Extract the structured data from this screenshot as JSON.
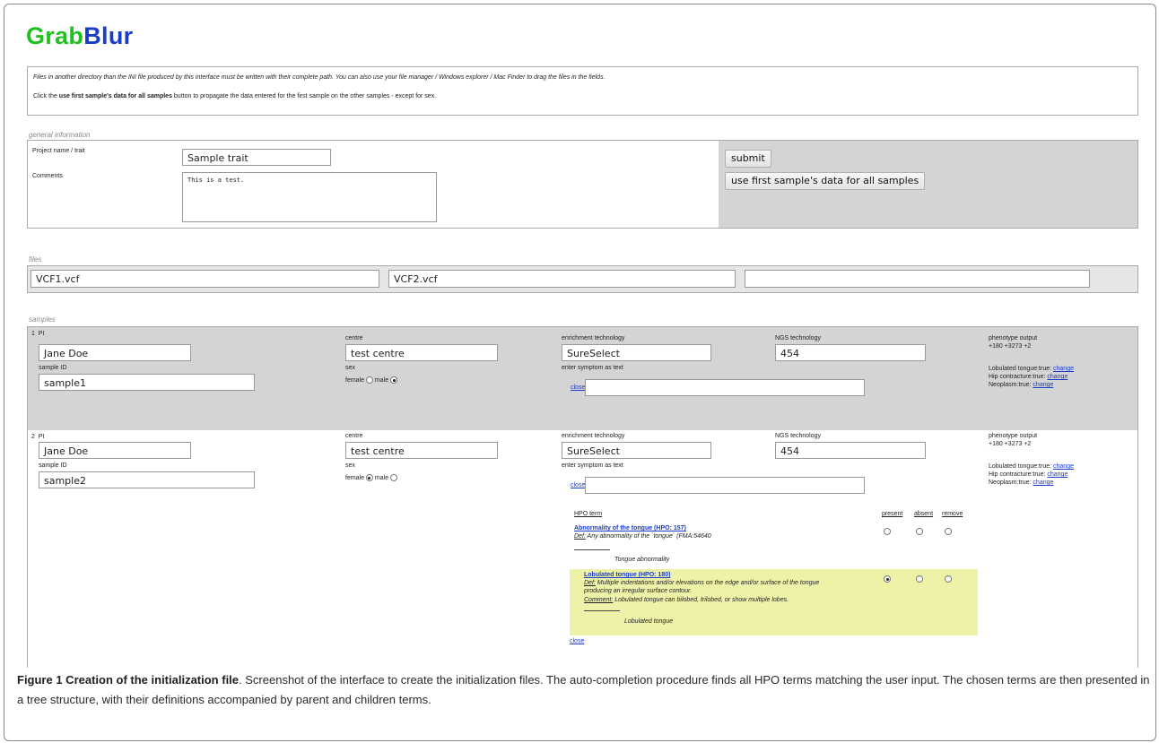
{
  "app": {
    "logo_part1": "Grab",
    "logo_part2": "Blur"
  },
  "info": {
    "line1": "Files in another directory than the INI file produced by this interface must be written with their complete path. You can also use your file manager / Windows explorer / Mac Finder to drag the files in the fields.",
    "line2_pre": "Click the ",
    "line2_bold": "use first sample's data for all samples",
    "line2_post": " button to propagate the data entered for the first sample on the other samples - except for sex."
  },
  "general": {
    "heading": "general information",
    "project_label": "Project name / trait",
    "project_value": "Sample trait",
    "comments_label": "Comments",
    "comments_value": "This is a test.",
    "submit_label": "submit",
    "use_first_label": "use first sample's data for all samples"
  },
  "files": {
    "heading": "files",
    "values": [
      "VCF1.vcf",
      "VCF2.vcf",
      ""
    ]
  },
  "samples": {
    "heading": "samples",
    "labels": {
      "pi": "PI",
      "sample_id": "sample ID",
      "centre": "centre",
      "sex": "sex",
      "female": "female",
      "male": "male",
      "enrichment": "enrichment technology",
      "ngs": "NGS technology",
      "symptom": "enter symptom as text",
      "close": "close",
      "phenotype_output": "phenotype output",
      "change": "change"
    },
    "items": [
      {
        "number": "1",
        "pi": "Jane Doe",
        "sample_id": "sample1",
        "centre": "test centre",
        "sex": "male",
        "enrichment": "SureSelect",
        "ngs": "454",
        "symptom": "",
        "phenotype_codes": "+180 +3273 +2",
        "phenotypes": [
          "Lobulated tongue:true:",
          "Hip contracture:true:",
          "Neoplasm:true:"
        ]
      },
      {
        "number": "2",
        "pi": "Jane Doe",
        "sample_id": "sample2",
        "centre": "test centre",
        "sex": "female",
        "enrichment": "SureSelect",
        "ngs": "454",
        "symptom": "",
        "phenotype_codes": "+180 +3273 +2",
        "phenotypes": [
          "Lobulated tongue:true:",
          "Hip contracture:true:",
          "Neoplasm:true:"
        ]
      }
    ]
  },
  "hpo": {
    "col_term": "HPO term",
    "col_present": "present",
    "col_absent": "absent",
    "col_remove": "remove",
    "terms": [
      {
        "title": "Abnormality of the tongue (HPO: 157)",
        "def_label": "Def:",
        "def": " Any abnormality of the `tongue` (FMA:54640",
        "child": "Tongue abnormality",
        "state": "none"
      },
      {
        "title": "Lobulated tongue (HPO: 180)",
        "def_label": "Def:",
        "def1": " Multiple indentations and/or elevations on the edge and/or surface of the tongue",
        "def2": "producing an irregular surface contour.",
        "comment_label": "Comment:",
        "comment": " Lobulated tongue can bilobed, trilobed, or show multiple lobes.",
        "child": "Lobulated tongue",
        "state": "present"
      }
    ],
    "close": "close"
  },
  "caption": {
    "title": "Figure 1 Creation of the initialization file",
    "text": ". Screenshot of the interface to create the initialization files. The auto-completion procedure finds all HPO terms matching the user input. The chosen terms are then presented in a tree structure, with their definitions accompanied by parent and children terms."
  },
  "colors": {
    "logo_green": "#21c021",
    "logo_blue": "#1a3cc8",
    "panel_grey": "#d4d4d4",
    "highlight": "#eef2a8",
    "link": "#1a3cc8"
  }
}
